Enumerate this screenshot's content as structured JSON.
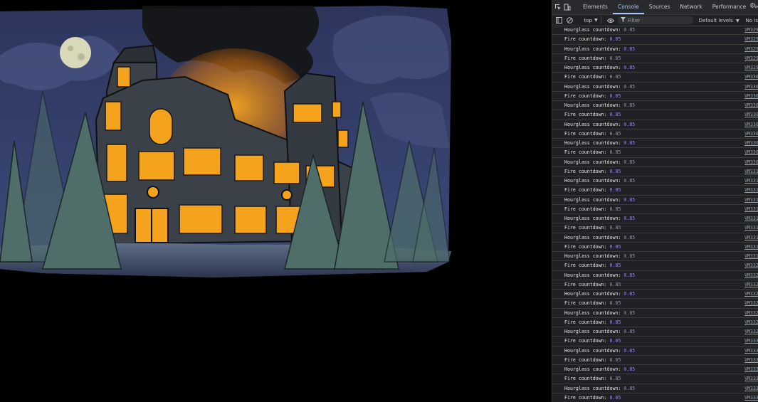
{
  "devtools": {
    "tabs": [
      "Elements",
      "Console",
      "Sources",
      "Network",
      "Performance"
    ],
    "active_tab": "Console",
    "more_tabs": "»",
    "toolbar": {
      "context": "top",
      "filter_placeholder": "Filter",
      "levels": "Default levels",
      "issues": "No is"
    },
    "log_value": "0.85",
    "rows": [
      {
        "label": "Hourglass countdown:",
        "value": "0.85",
        "src": "VM329"
      },
      {
        "label": "Fire countdown:",
        "value": "0.85",
        "src": "VM329"
      },
      {
        "label": "Hourglass countdown:",
        "value": "0.85",
        "src": "VM329"
      },
      {
        "label": "Fire countdown:",
        "value": "0.85",
        "src": "VM329"
      },
      {
        "label": "Hourglass countdown:",
        "value": "0.85",
        "src": "VM329"
      },
      {
        "label": "Fire countdown:",
        "value": "0.85",
        "src": "VM330"
      },
      {
        "label": "Hourglass countdown:",
        "value": "0.85",
        "src": "VM330"
      },
      {
        "label": "Fire countdown:",
        "value": "0.85",
        "src": "VM330"
      },
      {
        "label": "Hourglass countdown:",
        "value": "0.85",
        "src": "VM330"
      },
      {
        "label": "Fire countdown:",
        "value": "0.85",
        "src": "VM330"
      },
      {
        "label": "Hourglass countdown:",
        "value": "0.85",
        "src": "VM330"
      },
      {
        "label": "Fire countdown:",
        "value": "0.85",
        "src": "VM330"
      },
      {
        "label": "Hourglass countdown:",
        "value": "0.85",
        "src": "VM330"
      },
      {
        "label": "Fire countdown:",
        "value": "0.85",
        "src": "VM330"
      },
      {
        "label": "Hourglass countdown:",
        "value": "0.85",
        "src": "VM330"
      },
      {
        "label": "Fire countdown:",
        "value": "0.85",
        "src": "VM331"
      },
      {
        "label": "Hourglass countdown:",
        "value": "0.85",
        "src": "VM331"
      },
      {
        "label": "Fire countdown:",
        "value": "0.85",
        "src": "VM331"
      },
      {
        "label": "Hourglass countdown:",
        "value": "0.85",
        "src": "VM331"
      },
      {
        "label": "Fire countdown:",
        "value": "0.85",
        "src": "VM331"
      },
      {
        "label": "Hourglass countdown:",
        "value": "0.85",
        "src": "VM331"
      },
      {
        "label": "Fire countdown:",
        "value": "0.85",
        "src": "VM331"
      },
      {
        "label": "Hourglass countdown:",
        "value": "0.85",
        "src": "VM331"
      },
      {
        "label": "Fire countdown:",
        "value": "0.85",
        "src": "VM331"
      },
      {
        "label": "Hourglass countdown:",
        "value": "0.85",
        "src": "VM331"
      },
      {
        "label": "Fire countdown:",
        "value": "0.85",
        "src": "VM332"
      },
      {
        "label": "Hourglass countdown:",
        "value": "0.85",
        "src": "VM332"
      },
      {
        "label": "Fire countdown:",
        "value": "0.85",
        "src": "VM332"
      },
      {
        "label": "Hourglass countdown:",
        "value": "0.85",
        "src": "VM332"
      },
      {
        "label": "Fire countdown:",
        "value": "0.85",
        "src": "VM332"
      },
      {
        "label": "Hourglass countdown:",
        "value": "0.85",
        "src": "VM332"
      },
      {
        "label": "Fire countdown:",
        "value": "0.85",
        "src": "VM332"
      },
      {
        "label": "Hourglass countdown:",
        "value": "0.85",
        "src": "VM332"
      },
      {
        "label": "Fire countdown:",
        "value": "0.85",
        "src": "VM333"
      },
      {
        "label": "Hourglass countdown:",
        "value": "0.85",
        "src": "VM333"
      },
      {
        "label": "Fire countdown:",
        "value": "0.85",
        "src": "VM333"
      },
      {
        "label": "Hourglass countdown:",
        "value": "0.85",
        "src": "VM333"
      },
      {
        "label": "Fire countdown:",
        "value": "0.85",
        "src": "VM333"
      },
      {
        "label": "Hourglass countdown:",
        "value": "0.85",
        "src": "VM333"
      },
      {
        "label": "Fire countdown:",
        "value": "0.85",
        "src": "VM333"
      }
    ]
  },
  "icons": {
    "inspect": "inspect-element-icon",
    "device": "device-toolbar-icon",
    "sidebar": "console-sidebar-icon",
    "clear": "clear-console-icon",
    "eye": "live-expression-icon",
    "filter": "filter-icon",
    "settings": "settings-gear-icon"
  },
  "colors": {
    "sky": "#34406e",
    "moon": "#d8d9b8",
    "window_glow": "#f5a21c",
    "building": "#3b4148",
    "tree": "#4f6e6a",
    "console_bg": "#202124",
    "log_value": "#9980ff",
    "active_tab": "#a8c7fa"
  }
}
